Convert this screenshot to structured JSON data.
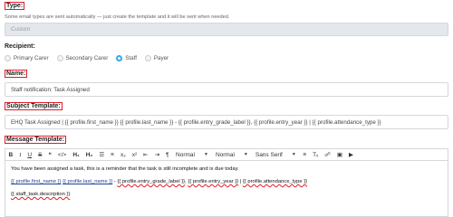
{
  "type_section": {
    "label": "Type:",
    "hint": "Some email types are sent automatically — just create the template and it will be sent when needed.",
    "value": "Custom"
  },
  "recipient": {
    "label": "Recipient:",
    "options": [
      "Primary Carer",
      "Secondary Carer",
      "Staff",
      "Payer"
    ],
    "selected": "Staff"
  },
  "name": {
    "label": "Name:",
    "value": "Staff notification: Task Assigned"
  },
  "subject": {
    "label": "Subject Template:",
    "value": "EHQ Task Assigned | {{ profile.first_name }} {{ profile.last_name }} - {{ profile.entry_grade_label }}, {{ profile.entry_year }} | {{ profile.attendance_type }}"
  },
  "message": {
    "label": "Message Template:",
    "toolbar": {
      "bold": "B",
      "italic": "I",
      "underline": "U",
      "strike": "S",
      "quote": "❝",
      "code": "</>",
      "h1": "H₁",
      "h2": "H₂",
      "ordered_list": "☰",
      "bullet_list": "≡",
      "subscript": "x₂",
      "superscript": "x²",
      "outdent": "⇤",
      "indent": "⇥",
      "rtl": "¶",
      "size1": "Normal",
      "size2": "Normal",
      "font": "Sans Serif",
      "align": "≡",
      "clean": "Tₓ",
      "link": "☍",
      "image": "▣",
      "video": "▶"
    },
    "body": {
      "line1": "You have been assigned a task, this is a reminder that the task is still incomplete and is due today.",
      "line2": {
        "first_name": "{{ profile.first_name }}",
        "last_name": "{{ profile.last_name }}",
        "sep1": " - ",
        "grade": "{{ profile.entry_grade_label }}",
        "sep2": ", ",
        "year": "{{ profile.entry_year }}",
        "sep3": " | ",
        "attendance": "{{ profile.attendance_type }}"
      },
      "line3": "{{ staff_task.description }}"
    }
  }
}
